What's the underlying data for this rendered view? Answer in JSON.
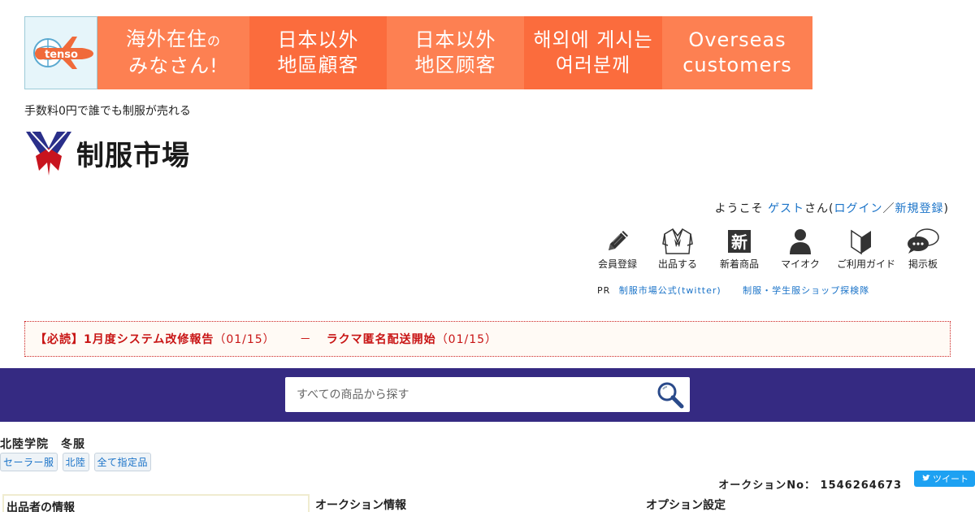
{
  "banner": {
    "logo_text": "tenso",
    "cells": [
      {
        "line1": "海外在住",
        "line1_small": "の",
        "line2": "みなさん!"
      },
      {
        "line1": "日本以外",
        "line2": "地區顧客"
      },
      {
        "line1": "日本以外",
        "line2": "地区顾客"
      },
      {
        "line1": "해외에 게시는",
        "line2": "여러분께"
      },
      {
        "line1": "Overseas",
        "line2": "customers"
      }
    ],
    "colors": {
      "orange_light": "#fd8052",
      "orange_dark": "#fb6c3d"
    }
  },
  "header": {
    "tagline": "手数料0円で誰でも制服が売れる",
    "site_title": "制服市場"
  },
  "welcome": {
    "prefix": "ようこそ",
    "guest": "ゲスト",
    "suffix": "さん(",
    "login": "ログイン",
    "slash": "／",
    "register": "新規登録",
    "close": ")"
  },
  "icon_nav": [
    {
      "label": "会員登録",
      "icon": "pencil-icon"
    },
    {
      "label": "出品する",
      "icon": "sailor-uniform-icon"
    },
    {
      "label": "新着商品",
      "icon": "new-badge-icon"
    },
    {
      "label": "マイオク",
      "icon": "person-icon"
    },
    {
      "label": "ご利用ガイド",
      "icon": "beginner-mark-icon"
    },
    {
      "label": "掲示板",
      "icon": "chat-bubbles-icon"
    }
  ],
  "pr": {
    "label": "PR",
    "link1": "制服市場公式(twitter)",
    "link2": "制服・学生服ショップ探検隊"
  },
  "notice": {
    "item1_text": "【必読】1月度システム改修報告",
    "item1_date": "（01/15）",
    "separator": "－",
    "item2_text": "ラクマ匿名配送開始",
    "item2_date": "（01/15）"
  },
  "search": {
    "placeholder": "すべての商品から探す",
    "bar_color": "#352a82"
  },
  "item": {
    "title": "北陸学院　冬服",
    "tags": [
      "セーラー服",
      "北陸",
      "全て指定品"
    ],
    "auction_no_label": "オークションNo：",
    "auction_no": "1546264673",
    "tweet_label": "ツイート"
  },
  "sections": {
    "seller": "出品者の情報",
    "auction": "オークション情報",
    "option": "オプション設定"
  }
}
